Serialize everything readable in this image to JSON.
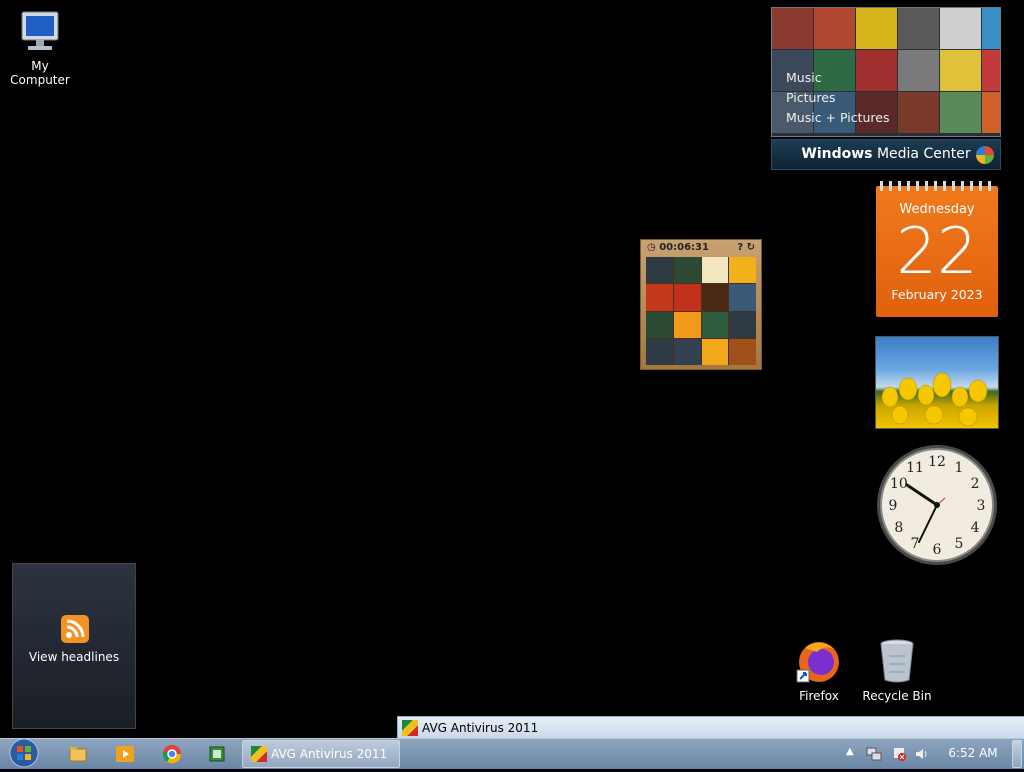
{
  "desktop": {
    "my_computer": "My Computer",
    "firefox": "Firefox",
    "recycle_bin": "Recycle Bin"
  },
  "media_center": {
    "menu": [
      "Music",
      "Pictures",
      "Music + Pictures"
    ],
    "title_bold": "Windows",
    "title_rest": " Media Center"
  },
  "calendar": {
    "weekday": "Wednesday",
    "day": "22",
    "month_year": "February 2023"
  },
  "clock_gadget": {
    "numerals": [
      "12",
      "1",
      "2",
      "3",
      "4",
      "5",
      "6",
      "7",
      "8",
      "9",
      "10",
      "11"
    ]
  },
  "puzzle": {
    "timer": "00:06:31"
  },
  "rss": {
    "label": "View headlines"
  },
  "avg_strip": {
    "label": "AVG Antivirus 2011"
  },
  "taskbar": {
    "avg_button": "AVG Antivirus 2011",
    "time": "6:52 AM"
  }
}
